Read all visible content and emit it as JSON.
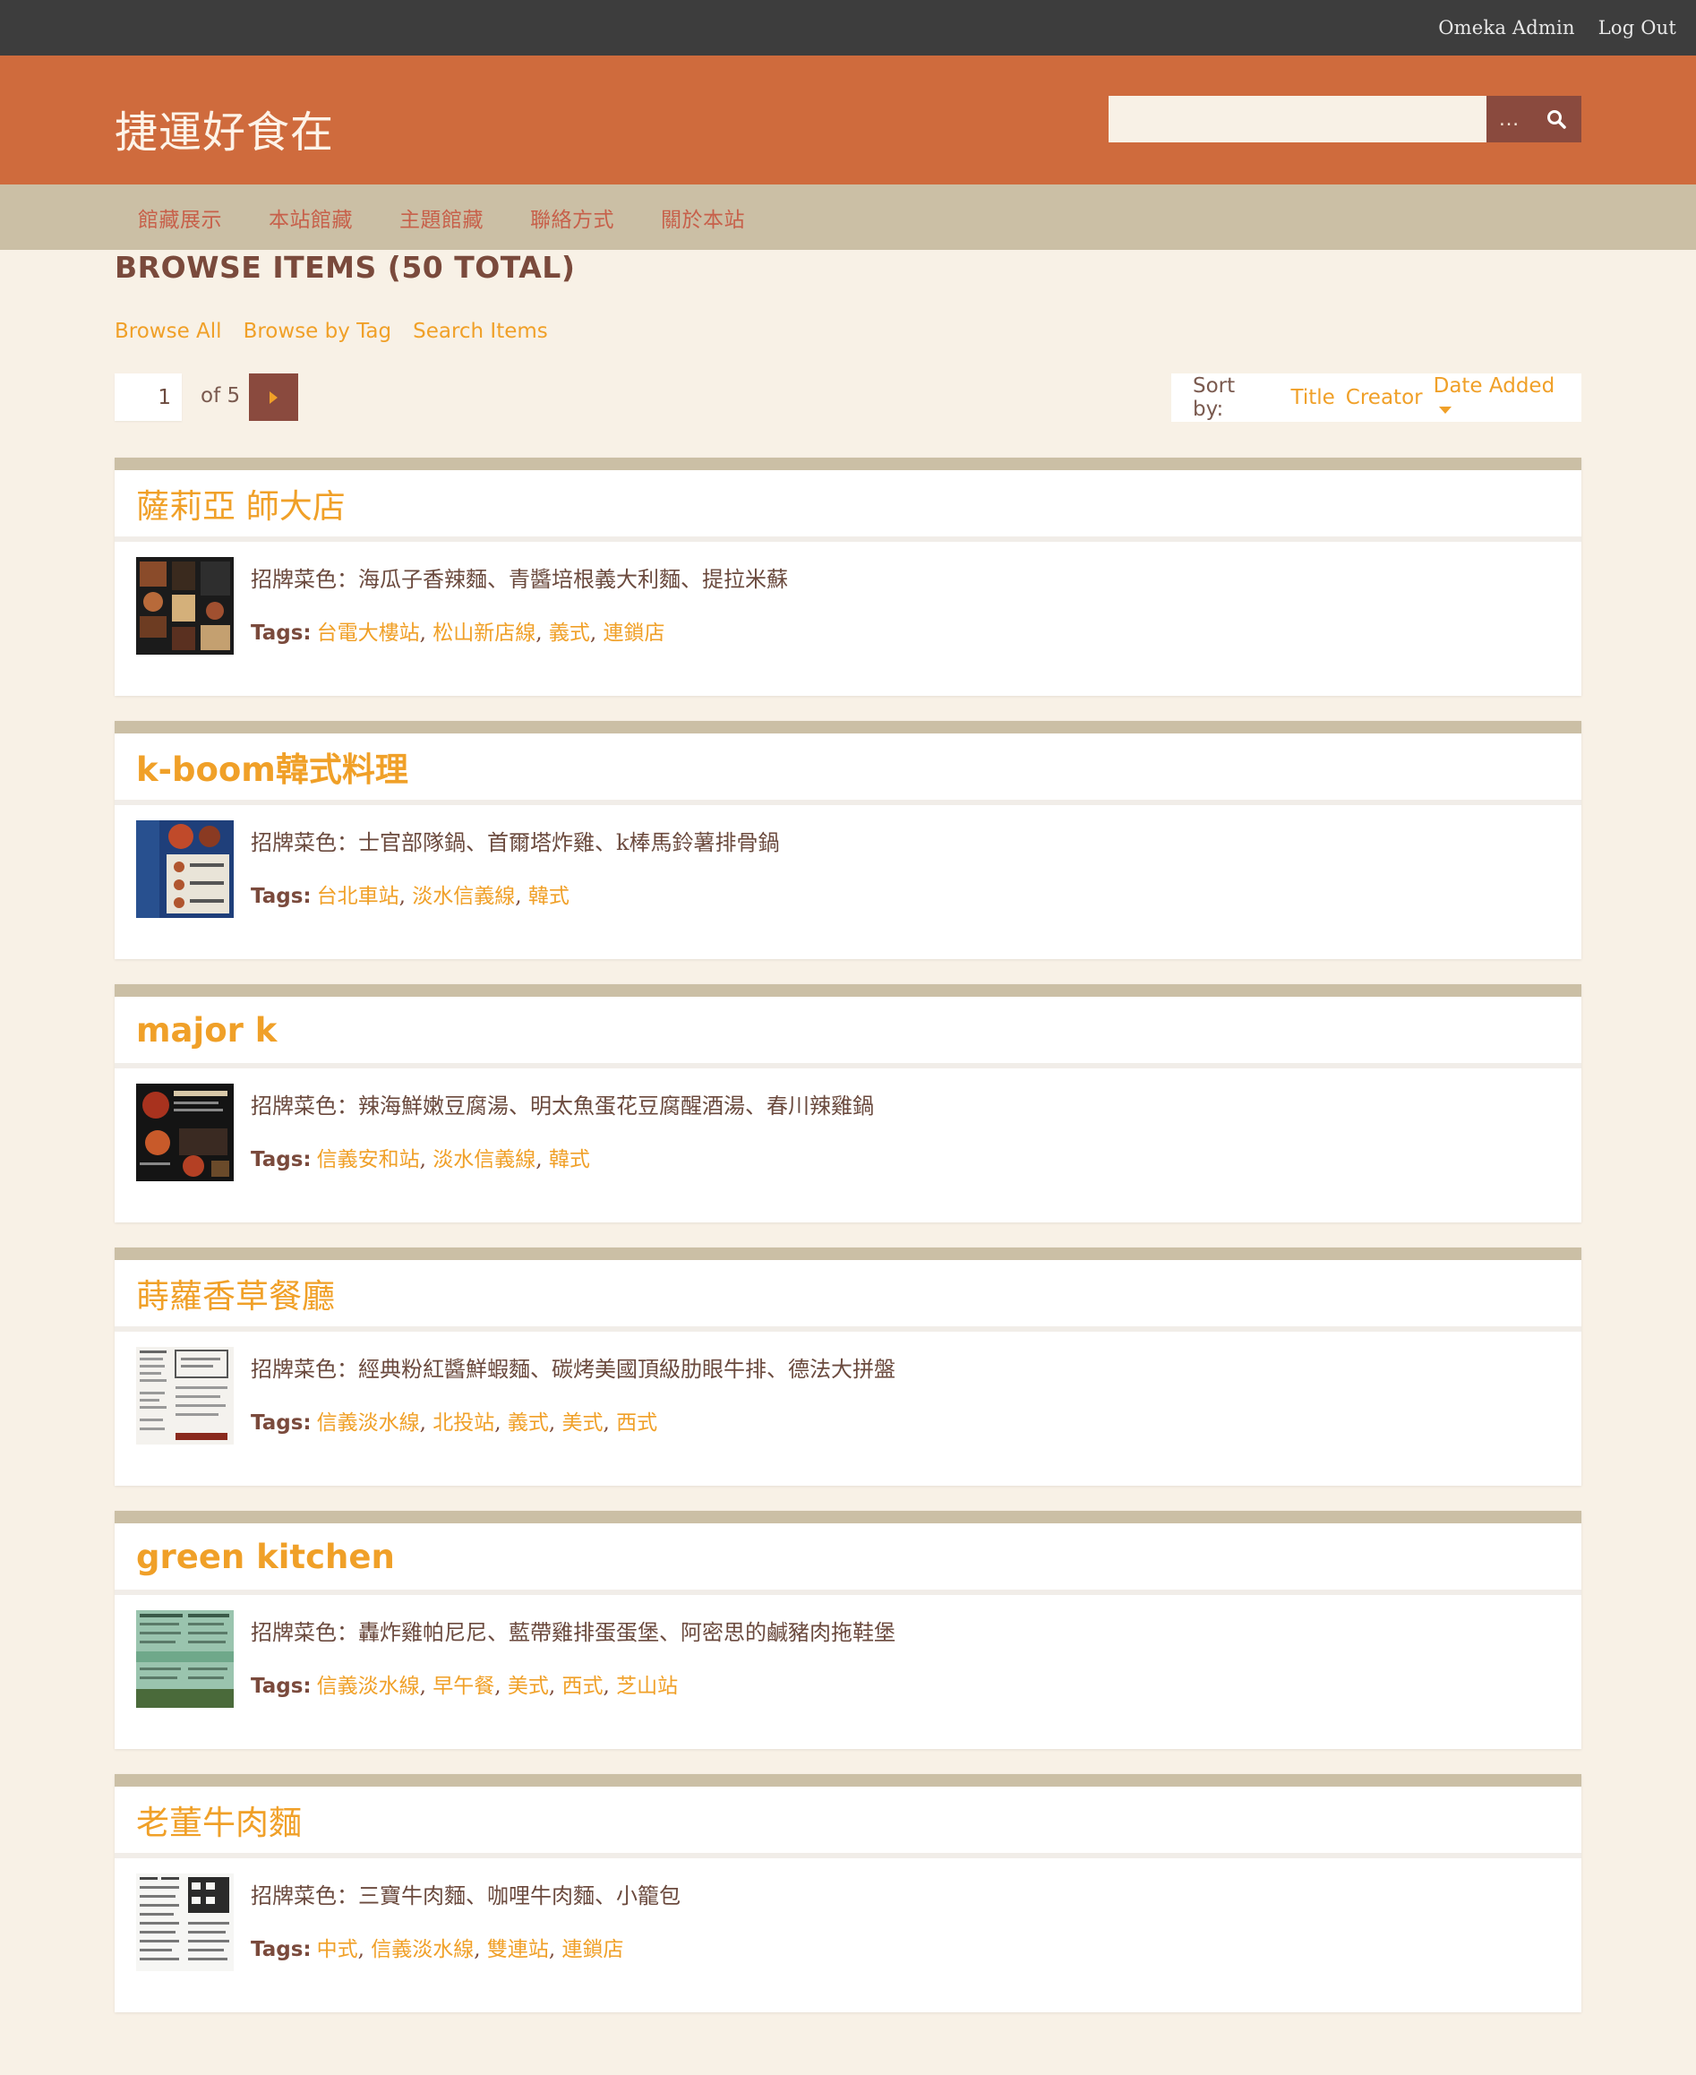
{
  "admin_bar": {
    "admin_link": "Omeka Admin",
    "logout_link": "Log Out"
  },
  "header": {
    "site_title": "捷運好食在",
    "search": {
      "placeholder": "",
      "advanced_label": "…"
    }
  },
  "nav": [
    "館藏展示",
    "本站館藏",
    "主題館藏",
    "聯絡方式",
    "關於本站"
  ],
  "page": {
    "heading": "BROWSE ITEMS (50 TOTAL)",
    "sub_nav": [
      "Browse All",
      "Browse by Tag",
      "Search Items"
    ]
  },
  "pagination": {
    "current_page": "1",
    "of_text": "of 5"
  },
  "sort": {
    "label": "Sort by:",
    "options": [
      "Title",
      "Creator",
      "Date Added"
    ],
    "active": "Date Added"
  },
  "items": [
    {
      "title": "薩莉亞 師大店",
      "description": "招牌菜色：海瓜子香辣麵、青醬培根義大利麵、提拉米蘇",
      "tags_label": "Tags:",
      "tags": [
        "台電大樓站",
        "松山新店線",
        "義式",
        "連鎖店"
      ]
    },
    {
      "title": "k-boom韓式料理",
      "description": "招牌菜色：士官部隊鍋、首爾塔炸雞、k棒馬鈴薯排骨鍋",
      "tags_label": "Tags:",
      "tags": [
        "台北車站",
        "淡水信義線",
        "韓式"
      ]
    },
    {
      "title": "major k",
      "description": "招牌菜色：辣海鮮嫩豆腐湯、明太魚蛋花豆腐醒酒湯、春川辣雞鍋",
      "tags_label": "Tags:",
      "tags": [
        "信義安和站",
        "淡水信義線",
        "韓式"
      ]
    },
    {
      "title": "蒔蘿香草餐廳",
      "description": "招牌菜色：經典粉紅醬鮮蝦麵、碳烤美國頂級肋眼牛排、德法大拼盤",
      "tags_label": "Tags:",
      "tags": [
        "信義淡水線",
        "北投站",
        "義式",
        "美式",
        "西式"
      ]
    },
    {
      "title": "green kitchen",
      "description": "招牌菜色：轟炸雞帕尼尼、藍帶雞排蛋蛋堡、阿密思的鹹豬肉拖鞋堡",
      "tags_label": "Tags:",
      "tags": [
        "信義淡水線",
        "早午餐",
        "美式",
        "西式",
        "芝山站"
      ]
    },
    {
      "title": "老董牛肉麵",
      "description": "招牌菜色：三寶牛肉麵、咖哩牛肉麵、小籠包",
      "tags_label": "Tags:",
      "tags": [
        "中式",
        "信義淡水線",
        "雙連站",
        "連鎖店"
      ]
    }
  ]
}
